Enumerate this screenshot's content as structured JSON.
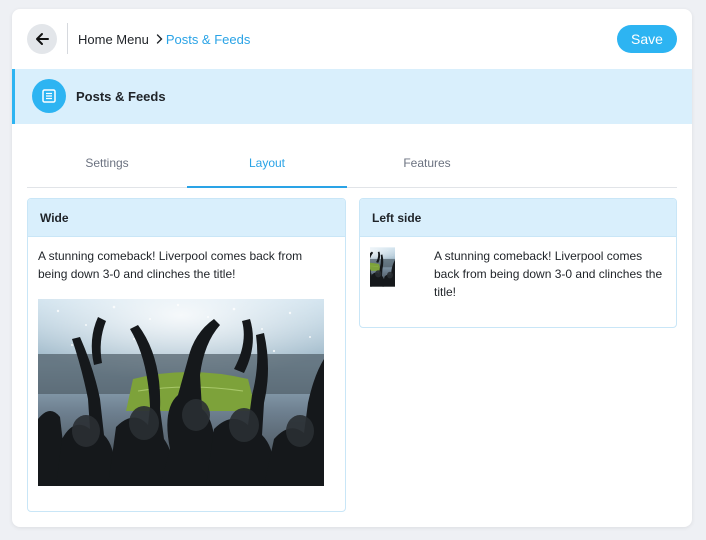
{
  "header": {
    "back_icon": "arrow-left-icon",
    "breadcrumb": {
      "root": "Home Menu",
      "separator_icon": "chevron-right-icon",
      "current": "Posts & Feeds"
    },
    "save_label": "Save"
  },
  "section": {
    "icon": "document-list-icon",
    "title": "Posts & Feeds"
  },
  "tabs": [
    {
      "label": "Settings",
      "active": false
    },
    {
      "label": "Layout",
      "active": true
    },
    {
      "label": "Features",
      "active": false
    }
  ],
  "layouts": {
    "wide": {
      "title": "Wide",
      "post_text": "A stunning comeback! Liverpool comes back from being down 3-0 and clinches the title!"
    },
    "left_side": {
      "title": "Left side",
      "post_text": "A stunning comeback! Liverpool comes back from being down 3-0 and clinches the title!"
    }
  },
  "colors": {
    "accent": "#2db4f2",
    "link": "#2aa3e6",
    "banner_bg": "#d9effc",
    "card_border": "#c9e6f7"
  }
}
